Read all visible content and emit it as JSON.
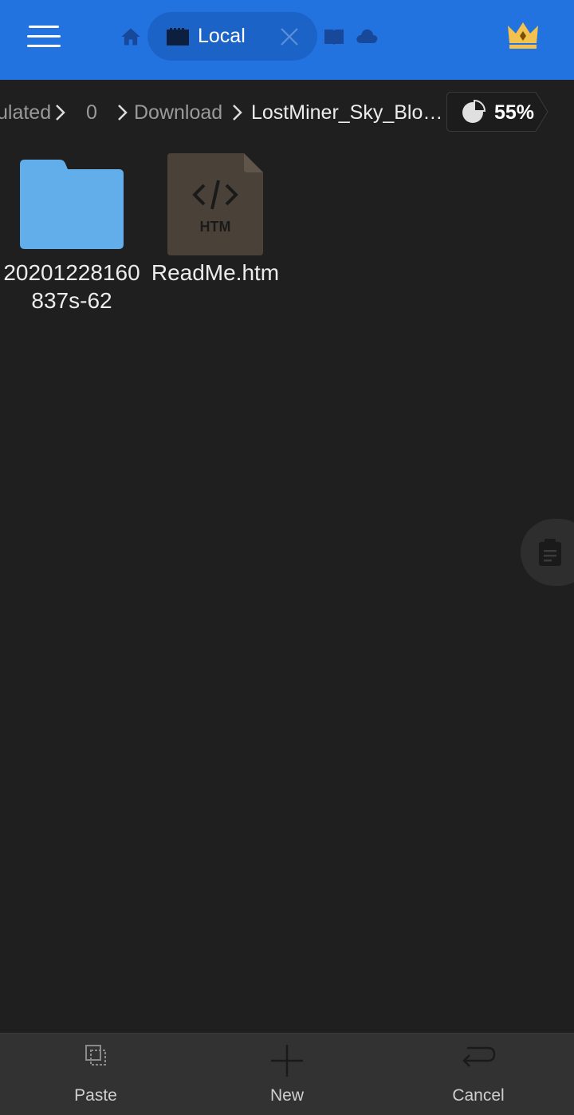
{
  "topbar": {
    "tabs": [
      {
        "label": "Local"
      }
    ]
  },
  "breadcrumb": {
    "items": [
      "ulated",
      "0",
      "Download",
      "LostMiner_Sky_Blo…"
    ]
  },
  "storage": {
    "percent_label": "55%",
    "percent": 55
  },
  "files": [
    {
      "name": "20201228160837s-62",
      "type": "folder",
      "icon": "folder-icon"
    },
    {
      "name": "ReadMe.htm",
      "type": "htm",
      "icon": "htm-file-icon",
      "badge": "HTM"
    }
  ],
  "bottombar": {
    "paste_label": "Paste",
    "new_label": "New",
    "cancel_label": "Cancel"
  },
  "colors": {
    "accent": "#2273e0",
    "background": "#1f1f1f",
    "folder": "#62aeea",
    "htm_file": "#4a4238"
  }
}
